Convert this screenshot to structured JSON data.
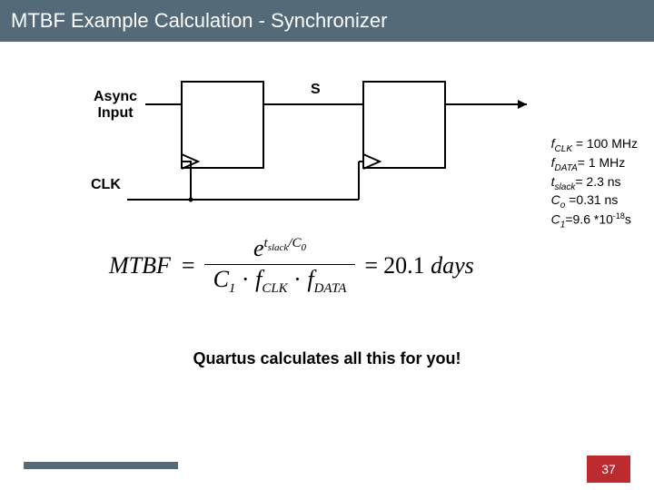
{
  "title": "MTBF Example Calculation - Synchronizer",
  "diagram": {
    "async_label": "Async\nInput",
    "signal_s": "S",
    "clk_label": "CLK"
  },
  "params": {
    "fclk": {
      "sym": "f",
      "sub": "CLK",
      "val": "100 MHz"
    },
    "fdata": {
      "sym": "f",
      "sub": "DATA",
      "val": "1 MHz"
    },
    "tslack": {
      "sym": "t",
      "sub": "slack",
      "val": "2.3 ns"
    },
    "co": {
      "sym": "C",
      "sub": "o",
      "val": "0.31 ns"
    },
    "c1": {
      "sym": "C",
      "sub": "1",
      "val": "9.6 *10",
      "exp": "-18",
      "unit": "s"
    }
  },
  "formula": {
    "lhs": "MTBF",
    "num_base": "e",
    "num_exp_t": "t",
    "num_exp_sub": "slack",
    "num_exp_div": "/C",
    "num_exp_div_sub": "0",
    "den_c": "C",
    "den_c_sub": "1",
    "den_dot1": "·",
    "den_f1": "f",
    "den_f1_sub": "CLK",
    "den_dot2": "·",
    "den_f2": "f",
    "den_f2_sub": "DATA",
    "result_val": "20.1",
    "result_unit": "days"
  },
  "note": "Quartus calculates all this for you!",
  "page": "37"
}
